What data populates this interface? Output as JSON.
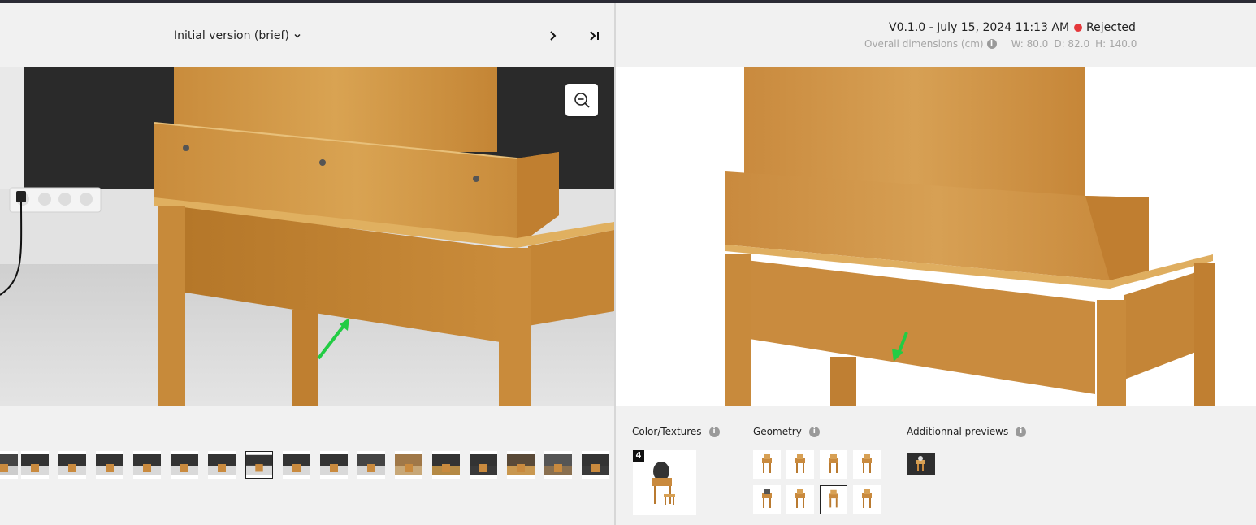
{
  "left_header": {
    "version_label": "Initial version (brief)"
  },
  "right_header": {
    "version": "V0.1.0 - July 15, 2024 11:13 AM",
    "status": "Rejected",
    "status_color": "#e5383b",
    "dims_label": "Overall dimensions (cm)",
    "width": "W: 80.0",
    "depth": "D: 82.0",
    "height": "H: 140.0"
  },
  "icons": {
    "chevron_down": "chevron-down-icon",
    "next": "chevron-right-icon",
    "last": "skip-to-end-icon",
    "zoom": "zoom-out-icon",
    "info": "i"
  },
  "thumbnails": {
    "count": 16,
    "selected_index": 6
  },
  "sections": {
    "color_textures": "Color/Textures",
    "geometry": "Geometry",
    "additional_previews": "Additionnal previews"
  },
  "texture_badge": "4",
  "geometry": {
    "count": 8,
    "selected_index": 6
  }
}
